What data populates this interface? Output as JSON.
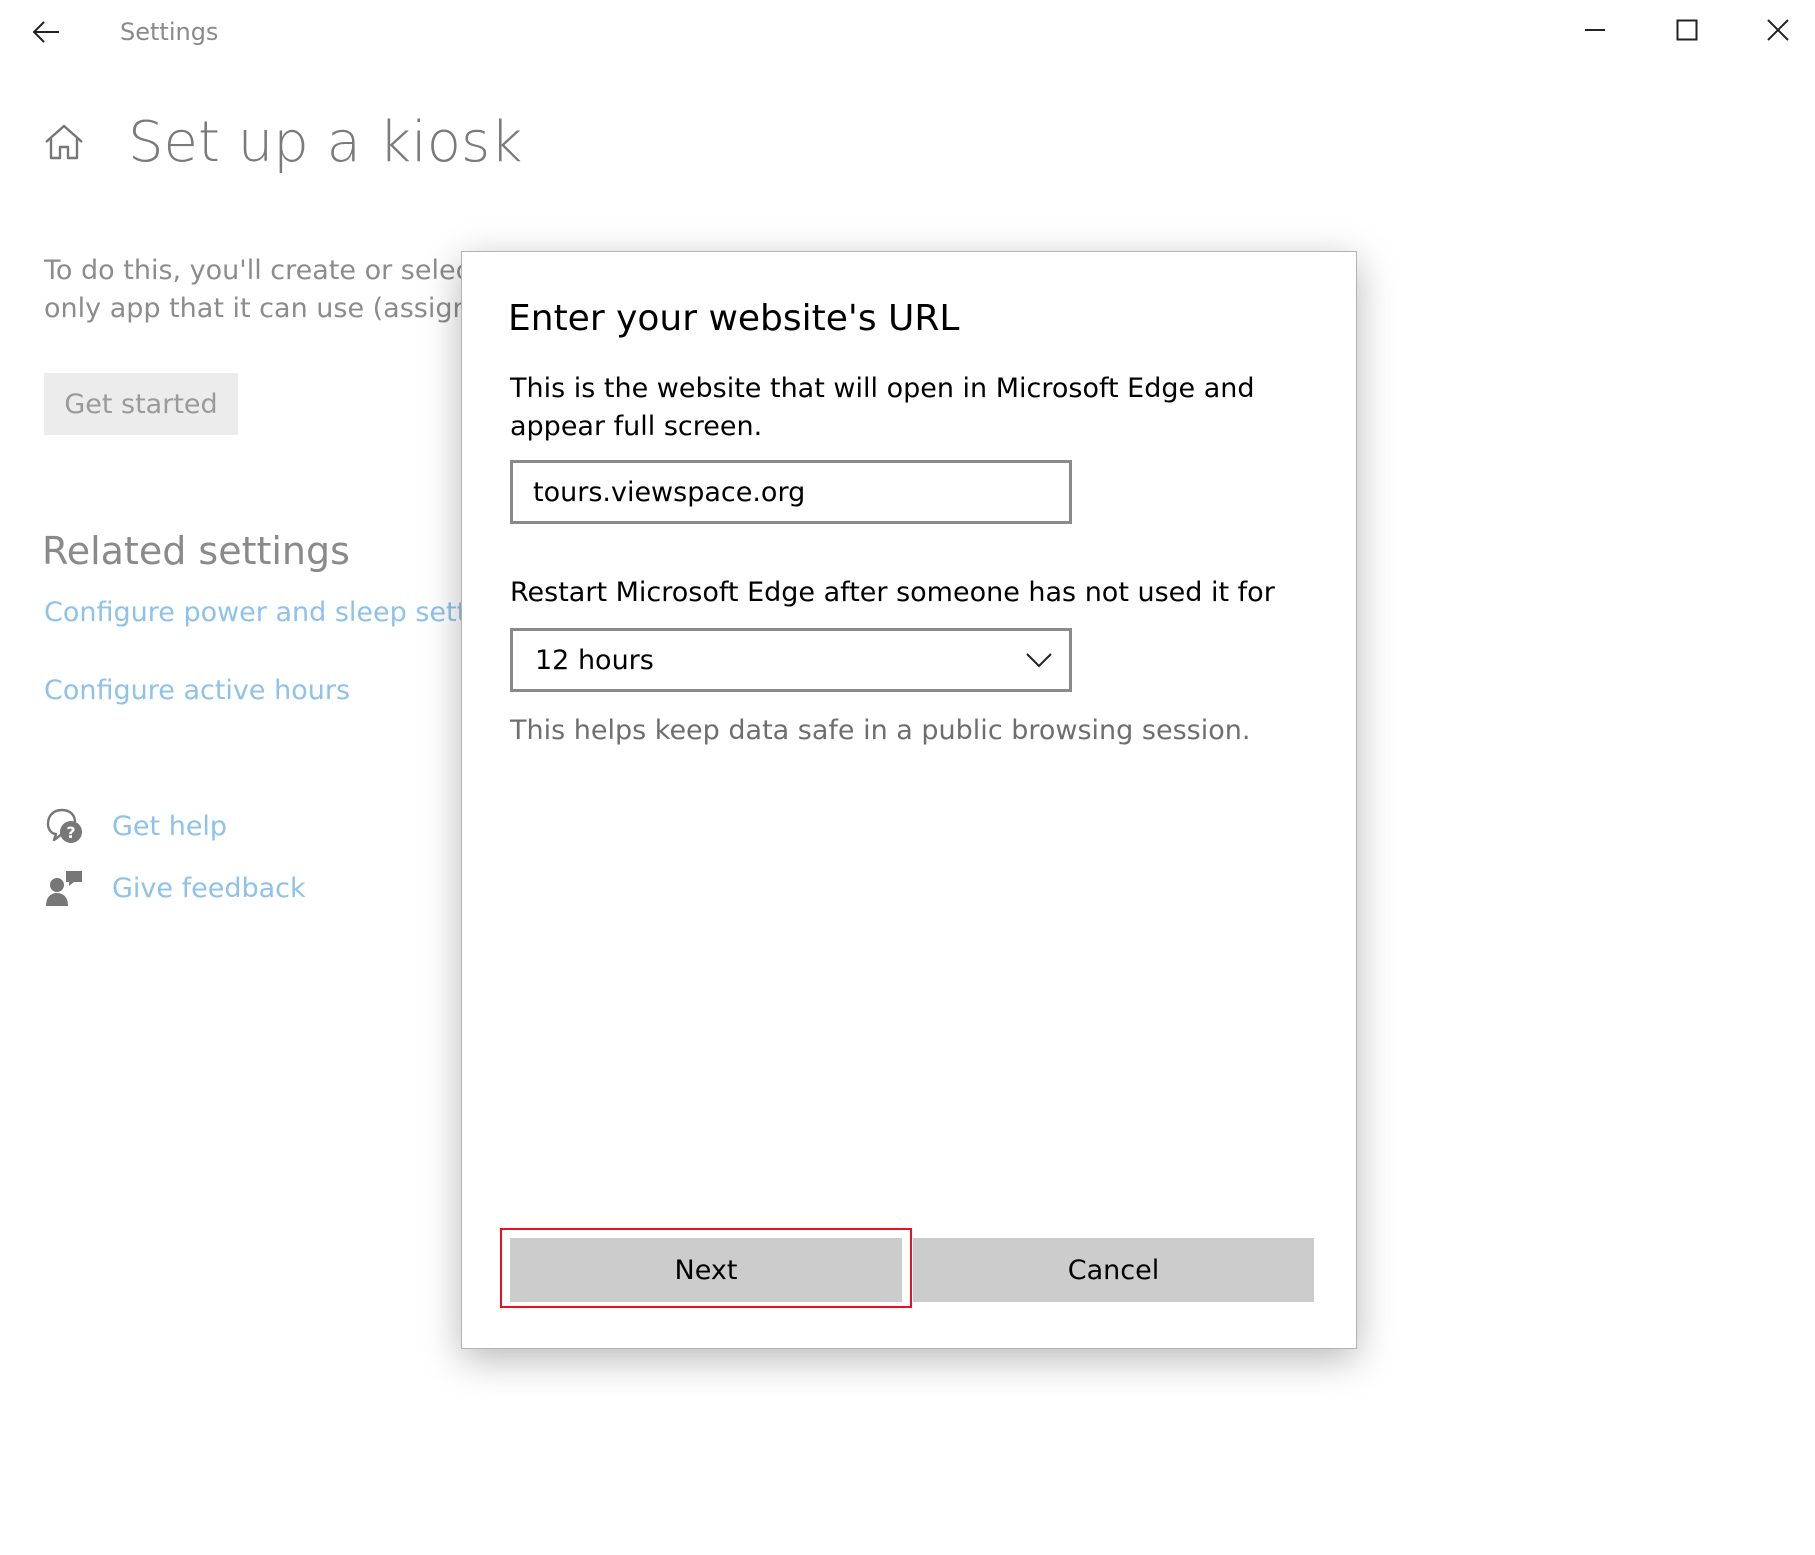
{
  "window": {
    "title": "Settings",
    "back_icon": "back-arrow-icon",
    "controls": {
      "minimize_icon": "minimize-icon",
      "maximize_icon": "maximize-icon",
      "close_icon": "close-icon"
    }
  },
  "page": {
    "home_icon": "home-icon",
    "title": "Set up a kiosk",
    "description_lines": [
      "To do this, you'll create or select a",
      "only app that it can use (assigned"
    ],
    "get_started_label": "Get started",
    "related_heading": "Related settings",
    "related_links": [
      "Configure power and sleep settings",
      "Configure active hours"
    ],
    "help": {
      "get_help_label": "Get help",
      "give_feedback_label": "Give feedback"
    }
  },
  "dialog": {
    "title": "Enter your website's URL",
    "description": "This is the website that will open in Microsoft Edge and appear full screen.",
    "url_value": "tours.viewspace.org",
    "restart_label": "Restart Microsoft Edge after someone has not used it for",
    "restart_selected": "12 hours",
    "helper_text": "This helps keep data safe in a public browsing session.",
    "next_label": "Next",
    "cancel_label": "Cancel"
  },
  "colors": {
    "link": "#8ec2ea",
    "button_bg": "#cccccc",
    "highlight": "#e81123",
    "muted_text": "#8a8a8a"
  }
}
